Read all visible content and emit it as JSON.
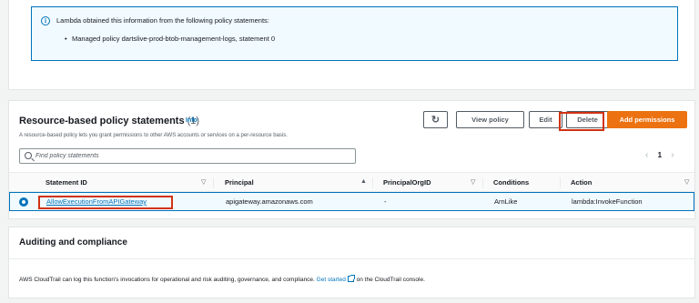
{
  "policy_info": {
    "title": "Lambda obtained this information from the following policy statements:",
    "bullet": "Managed policy dartslive-prod-btob-management-logs, statement 0"
  },
  "resource_policy": {
    "title": "Resource-based policy statements",
    "count": "(1)",
    "info_link": "Info",
    "description": "A resource-based policy lets you grant permissions to other AWS accounts or services on a per-resource basis.",
    "buttons": {
      "refresh": "↻",
      "view": "View policy",
      "edit": "Edit",
      "delete": "Delete",
      "add": "Add permissions"
    },
    "search_placeholder": "Find policy statements",
    "pagination": {
      "prev": "‹",
      "page": "1",
      "next": "›"
    },
    "columns": {
      "statement_id": "Statement ID",
      "principal": "Principal",
      "principal_org_id": "PrincipalOrgID",
      "conditions": "Conditions",
      "action": "Action"
    },
    "sort_icons": {
      "down": "▽",
      "up": "▲"
    },
    "row": {
      "statement_id": "AllowExecutionFromAPIGateway",
      "principal": "apigateway.amazonaws.com",
      "principal_org_id": "-",
      "conditions": "ArnLike",
      "action": "lambda:InvokeFunction",
      "selected": true
    }
  },
  "auditing": {
    "title": "Auditing and compliance",
    "text_before": "AWS CloudTrail can log this function's invocations for operational and risk auditing, governance, and compliance.",
    "link": "Get started",
    "text_after": "on the CloudTrail console."
  },
  "colors": {
    "accent": "#0073bb",
    "primary_button": "#ec7211",
    "highlight": "#d13212"
  }
}
